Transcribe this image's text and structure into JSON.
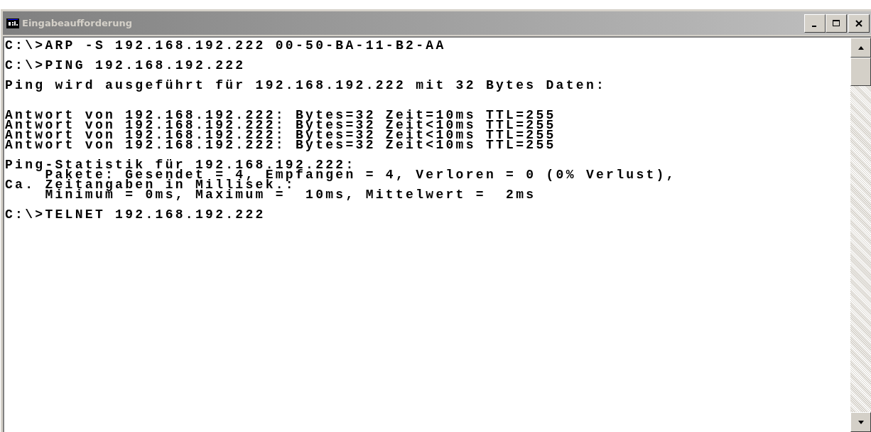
{
  "window": {
    "title": "Eingabeaufforderung",
    "active": false
  },
  "console": {
    "blocks": [
      [
        "C:\\>ARP -S 192.168.192.222 00-50-BA-11-B2-AA"
      ],
      [
        "C:\\>PING 192.168.192.222"
      ],
      [
        "Ping wird ausgeführt für 192.168.192.222 mit 32 Bytes Daten:"
      ],
      [
        "Antwort von 192.168.192.222: Bytes=32 Zeit=10ms TTL=255",
        "Antwort von 192.168.192.222: Bytes=32 Zeit<10ms TTL=255",
        "Antwort von 192.168.192.222: Bytes=32 Zeit<10ms TTL=255",
        "Antwort von 192.168.192.222: Bytes=32 Zeit<10ms TTL=255"
      ],
      [
        "Ping-Statistik für 192.168.192.222:",
        "    Pakete: Gesendet = 4, Empfangen = 4, Verloren = 0 (0% Verlust),",
        "Ca. Zeitangaben in Millisek.:",
        "    Minimum = 0ms, Maximum =  10ms, Mittelwert =  2ms"
      ],
      [
        "C:\\>TELNET 192.168.192.222"
      ]
    ]
  }
}
